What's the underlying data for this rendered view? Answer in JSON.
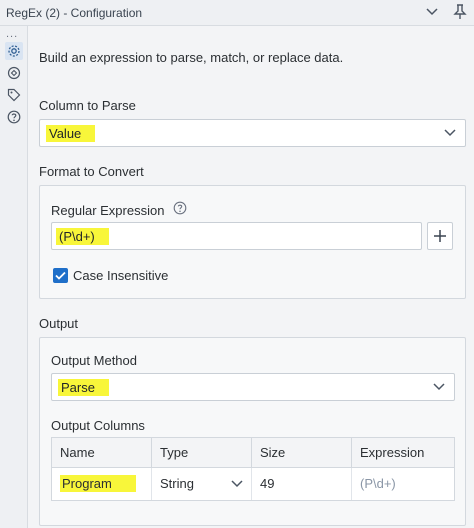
{
  "window": {
    "title": "RegEx (2) - Configuration"
  },
  "toolbar": {
    "chevron_icon": "chevron-down-icon",
    "pin_icon": "pin-icon"
  },
  "sidebar": {
    "more": "...",
    "items": [
      {
        "name": "configuration",
        "icon": "gear-icon",
        "active": true
      },
      {
        "name": "layout",
        "icon": "layout-icon",
        "active": false
      },
      {
        "name": "annotation",
        "icon": "tag-icon",
        "active": false
      },
      {
        "name": "help",
        "icon": "question-icon",
        "active": false
      }
    ]
  },
  "description": "Build an expression to parse, match, or replace data.",
  "column_to_parse": {
    "label": "Column to Parse",
    "value": "Value"
  },
  "format_to_convert": {
    "label": "Format to Convert",
    "regex_label": "Regular Expression",
    "regex_value": "(P\\d+)",
    "case_insensitive_label": "Case Insensitive",
    "case_insensitive_checked": true
  },
  "output": {
    "label": "Output",
    "method_label": "Output Method",
    "method_value": "Parse",
    "columns_label": "Output Columns",
    "table": {
      "headers": [
        "Name",
        "Type",
        "Size",
        "Expression"
      ],
      "rows": [
        {
          "name": "Program",
          "type": "String",
          "size": "49",
          "expression": "(P\\d+)"
        }
      ]
    }
  },
  "colors": {
    "highlight": "#f8f63a",
    "accent": "#1f6fc9"
  }
}
